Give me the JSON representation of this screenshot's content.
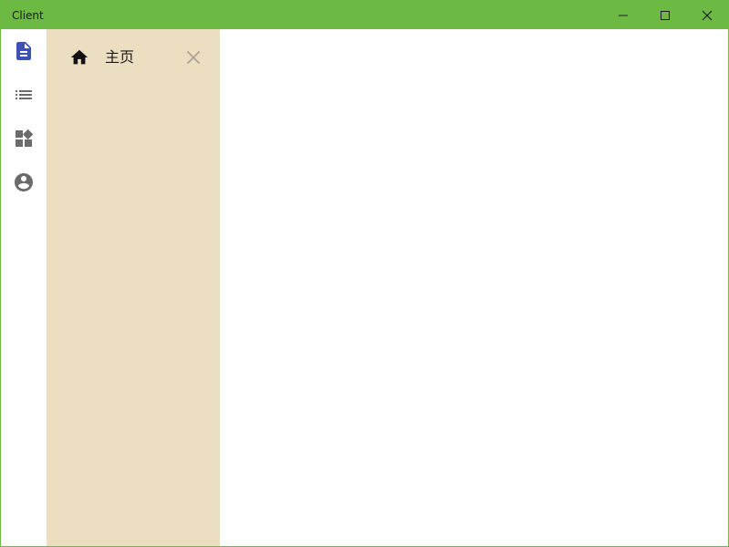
{
  "window": {
    "title": "Client"
  },
  "nav_rail": {
    "items": [
      {
        "icon": "document-icon",
        "active": true
      },
      {
        "icon": "list-icon",
        "active": false
      },
      {
        "icon": "widgets-icon",
        "active": false
      },
      {
        "icon": "account-icon",
        "active": false
      }
    ]
  },
  "drawer": {
    "items": [
      {
        "icon": "home-icon",
        "label": "主页"
      }
    ]
  },
  "colors": {
    "titlebar": "#6cba44",
    "drawer": "#ecdec1",
    "active_icon": "#3f51b5",
    "inactive_icon": "#6b6b6b"
  }
}
